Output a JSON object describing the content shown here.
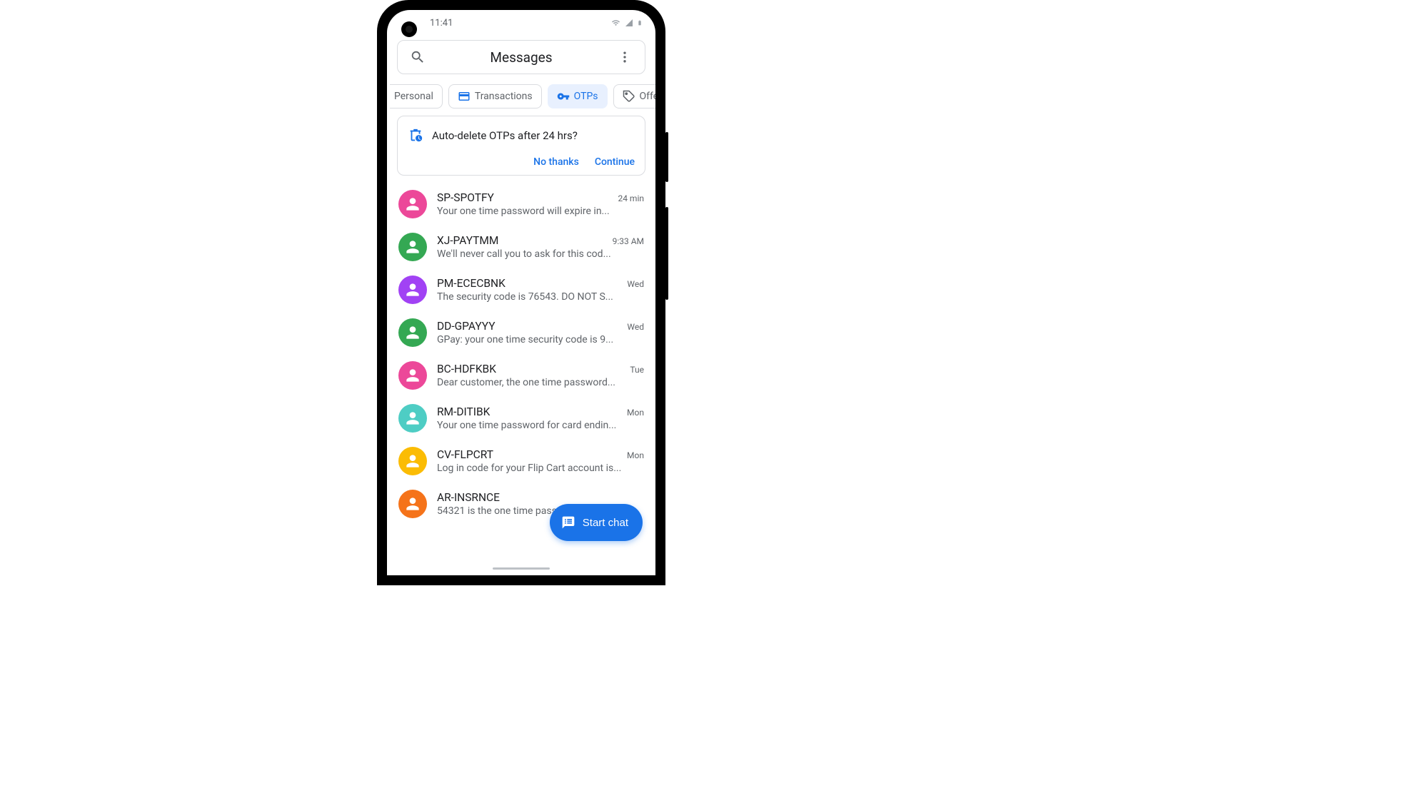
{
  "status": {
    "time": "11:41"
  },
  "header": {
    "title": "Messages"
  },
  "tabs": [
    {
      "label": "Personal"
    },
    {
      "label": "Transactions"
    },
    {
      "label": "OTPs"
    },
    {
      "label": "Offers"
    }
  ],
  "prompt": {
    "text": "Auto-delete OTPs after 24 hrs?",
    "no": "No thanks",
    "yes": "Continue"
  },
  "fab": {
    "label": "Start chat"
  },
  "conversations": [
    {
      "sender": "SP-SPOTFY",
      "preview": "Your one time password will expire in...",
      "time": "24 min",
      "color": "pink"
    },
    {
      "sender": "XJ-PAYTMM",
      "preview": "We'll never call you to ask for this cod...",
      "time": "9:33 AM",
      "color": "green"
    },
    {
      "sender": "PM-ECECBNK",
      "preview": "The security code is 76543. DO NOT S...",
      "time": "Wed",
      "color": "purple"
    },
    {
      "sender": "DD-GPAYYY",
      "preview": "GPay: your one time security code is 9...",
      "time": "Wed",
      "color": "green"
    },
    {
      "sender": "BC-HDFKBK",
      "preview": "Dear customer, the one time password...",
      "time": "Tue",
      "color": "pink"
    },
    {
      "sender": "RM-DITIBK",
      "preview": "Your one time password for card endin...",
      "time": "Mon",
      "color": "cyan"
    },
    {
      "sender": "CV-FLPCRT",
      "preview": "Log in code for your Flip Cart account is...",
      "time": "Mon",
      "color": "amber"
    },
    {
      "sender": "AR-INSRNCE",
      "preview": "54321 is the one time passw",
      "time": "",
      "color": "orange"
    }
  ]
}
